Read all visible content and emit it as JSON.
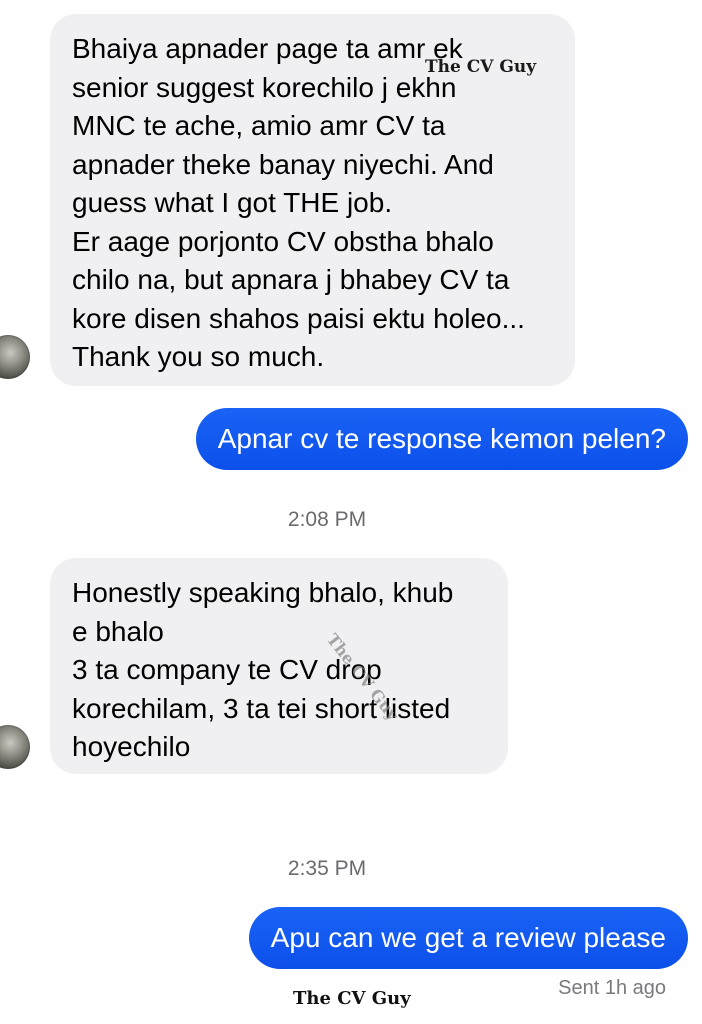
{
  "messages": [
    {
      "direction": "incoming",
      "lines": [
        "Bhaiya apnader page ta amr ek",
        "senior suggest korechilo j ekhn",
        "MNC te ache, amio amr CV ta",
        "apnader theke banay niyechi. And",
        "guess what I got THE job.",
        "Er aage porjonto CV obstha bhalo",
        "chilo na, but apnara j bhabey CV ta",
        "kore disen shahos paisi ektu holeo...",
        "Thank you so much."
      ]
    },
    {
      "direction": "outgoing",
      "text": "Apnar cv te response kemon pelen?"
    },
    {
      "direction": "timestamp",
      "text": "2:08 PM"
    },
    {
      "direction": "incoming",
      "lines": [
        "Honestly speaking bhalo, khub",
        "e bhalo",
        "3 ta company te CV drop",
        "korechilam, 3 ta tei short listed",
        "hoyechilo"
      ]
    },
    {
      "direction": "timestamp",
      "text": "2:35 PM"
    },
    {
      "direction": "outgoing",
      "text": "Apu can we get a review please"
    }
  ],
  "status": {
    "sent": "Sent 1h ago"
  },
  "watermarks": {
    "top": "The CV Guy",
    "diagonal": "The CV Guy",
    "bottom": "The CV Guy"
  },
  "colors": {
    "incoming_bubble": "#f0f0f2",
    "outgoing_bubble": "#0c50ea",
    "timestamp_text": "#6b6b6f"
  }
}
